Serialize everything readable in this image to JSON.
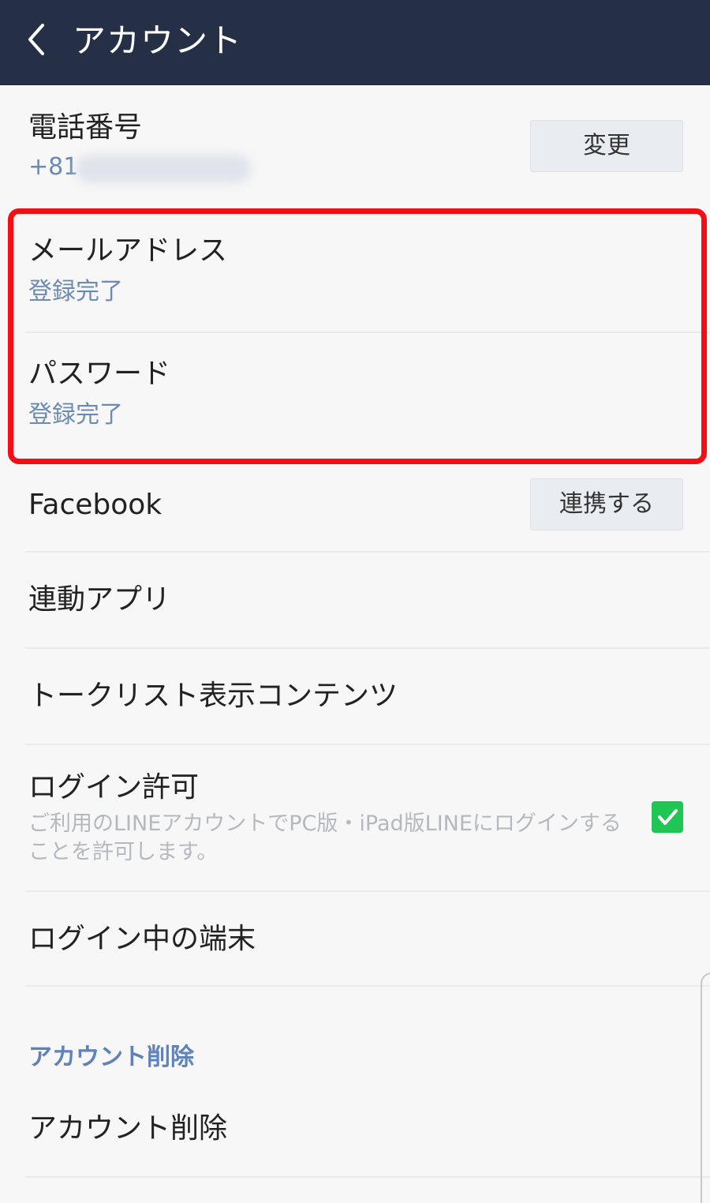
{
  "header": {
    "title": "アカウント",
    "back_icon": "chevron-left-icon"
  },
  "phone": {
    "title": "電話番号",
    "value": "+81",
    "button_label": "変更"
  },
  "email": {
    "title": "メールアドレス",
    "status": "登録完了"
  },
  "password": {
    "title": "パスワード",
    "status": "登録完了"
  },
  "facebook": {
    "title": "Facebook",
    "button_label": "連携する"
  },
  "linked_apps": {
    "title": "連動アプリ"
  },
  "talk_list": {
    "title": "トークリスト表示コンテンツ"
  },
  "login_permission": {
    "title": "ログイン許可",
    "description": "ご利用のLINEアカウントでPC版・iPad版LINEにログインすることを許可します。",
    "checked": true
  },
  "logged_in_devices": {
    "title": "ログイン中の端末"
  },
  "delete_section": {
    "label": "アカウント削除",
    "item_title": "アカウント削除"
  },
  "colors": {
    "header_bg": "#253047",
    "accent_blue": "#6c8ab2",
    "highlight_red": "#f20e14",
    "checkbox_green": "#20c654"
  }
}
